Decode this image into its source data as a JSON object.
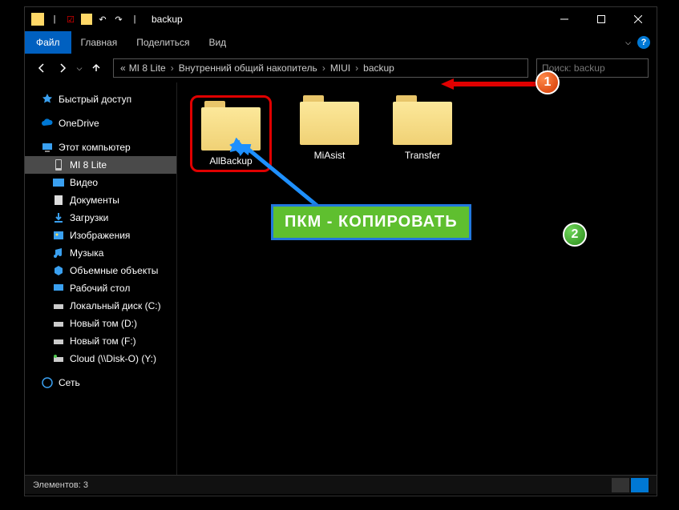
{
  "title": "backup",
  "ribbon": {
    "file": "Файл",
    "home": "Главная",
    "share": "Поделиться",
    "view": "Вид"
  },
  "breadcrumb": {
    "root": "MI 8 Lite",
    "internal": "Внутренний общий накопитель",
    "miui": "MIUI",
    "backup": "backup",
    "prefix": "«"
  },
  "search": {
    "placeholder": "Поиск: backup"
  },
  "sidebar": {
    "quick_access": "Быстрый доступ",
    "onedrive": "OneDrive",
    "this_pc": "Этот компьютер",
    "mi8": "MI 8 Lite",
    "video": "Видео",
    "documents": "Документы",
    "downloads": "Загрузки",
    "pictures": "Изображения",
    "music": "Музыка",
    "objects3d": "Объемные объекты",
    "desktop": "Рабочий стол",
    "disk_c": "Локальный диск (C:)",
    "disk_d": "Новый том (D:)",
    "disk_f": "Новый том (F:)",
    "disk_y": "Cloud (\\\\Disk-O) (Y:)",
    "network": "Сеть"
  },
  "folders": {
    "allbackup": "AllBackup",
    "miasist": "MiAsist",
    "transfer": "Transfer"
  },
  "statusbar": {
    "count": "Элементов: 3"
  },
  "callouts": {
    "one": "1",
    "two": "2",
    "tooltip": "ПКМ - КОПИРОВАТЬ"
  }
}
